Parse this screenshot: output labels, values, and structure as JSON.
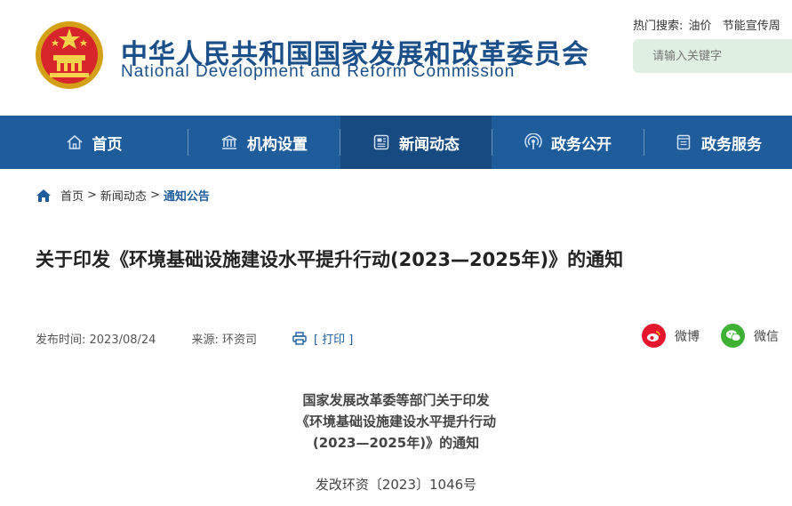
{
  "header": {
    "title_cn": "中华人民共和国国家发展和改革委员会",
    "title_en": "National Development and Reform Commission",
    "hot_search_label": "热门搜索:",
    "hot_search_terms": [
      "油价",
      "节能宣传周"
    ],
    "search_placeholder": "请输入关键字"
  },
  "nav": {
    "items": [
      {
        "label": "首页",
        "icon": "home-icon"
      },
      {
        "label": "机构设置",
        "icon": "building-icon"
      },
      {
        "label": "新闻动态",
        "icon": "news-icon"
      },
      {
        "label": "政务公开",
        "icon": "broadcast-icon"
      },
      {
        "label": "政务服务",
        "icon": "document-icon"
      }
    ],
    "active_index": 2
  },
  "breadcrumb": {
    "items": [
      "首页",
      "新闻动态",
      "通知公告"
    ],
    "separator": ">"
  },
  "article": {
    "title": "关于印发《环境基础设施建设水平提升行动(2023—2025年)》的通知",
    "publish_time": "发布时间: 2023/08/24",
    "source": "来源: 环资司",
    "print_label": "[ 打印 ]",
    "share": {
      "weibo": "微博",
      "wechat": "微信"
    },
    "doc_heading_lines": [
      "国家发展改革委等部门关于印发",
      "《环境基础设施建设水平提升行动",
      "(2023—2025年)》的通知"
    ],
    "doc_number": "发改环资〔2023〕1046号"
  },
  "colors": {
    "nav_bg": "#1f5c9b",
    "nav_active": "#174a80",
    "title_blue": "#1a4f8a",
    "weibo_red": "#e6162d",
    "wechat_green": "#3eb135"
  }
}
